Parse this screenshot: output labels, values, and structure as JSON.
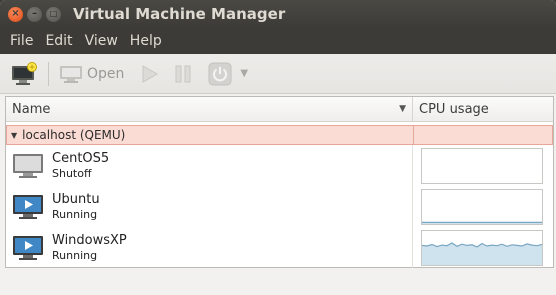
{
  "window": {
    "title": "Virtual Machine Manager"
  },
  "menu": {
    "items": [
      "File",
      "Edit",
      "View",
      "Help"
    ]
  },
  "toolbar": {
    "new_icon": "new-vm-icon",
    "open_label": "Open",
    "run_icon": "play-icon",
    "pause_icon": "pause-icon",
    "shutdown_icon": "power-icon",
    "dropdown_icon": "chevron-down-icon"
  },
  "list": {
    "columns": {
      "name": "Name",
      "cpu": "CPU usage"
    },
    "group": {
      "label": "localhost (QEMU)"
    },
    "vms": [
      {
        "name": "CentOS5",
        "status": "Shutoff",
        "state": "off",
        "cpu_history": []
      },
      {
        "name": "Ubuntu",
        "status": "Running",
        "state": "running",
        "cpu_history": [
          2,
          2,
          2,
          2,
          2,
          2,
          2,
          2,
          2,
          2,
          2,
          2,
          2,
          2,
          2,
          2,
          2,
          2,
          2,
          2
        ]
      },
      {
        "name": "WindowsXP",
        "status": "Running",
        "state": "running",
        "cpu_history": [
          62,
          60,
          65,
          58,
          63,
          61,
          70,
          59,
          66,
          62,
          64,
          57,
          68,
          60,
          63,
          61,
          66,
          59,
          64,
          62,
          60,
          67,
          63,
          61,
          65
        ]
      }
    ]
  },
  "colors": {
    "graph_line": "#7aa6c2",
    "graph_fill": "#cfe3ef",
    "group_bg": "#fbdcd4"
  }
}
